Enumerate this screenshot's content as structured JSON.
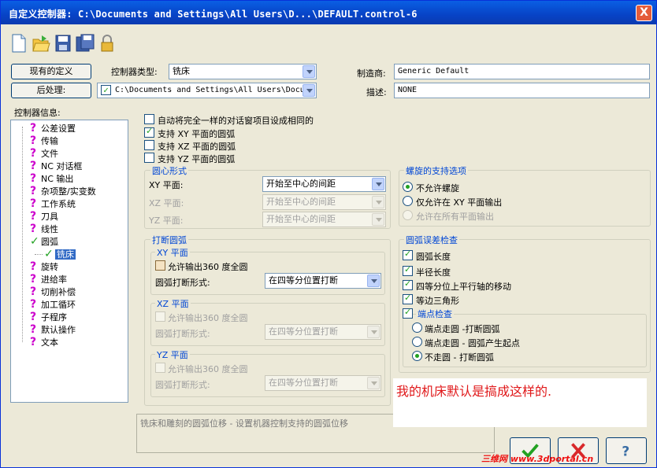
{
  "window": {
    "title": "自定义控制器: C:\\Documents and Settings\\All Users\\D...\\DEFAULT.control-6",
    "close_glyph": "X"
  },
  "toolbar": {
    "icons": [
      "new-file-icon",
      "open-folder-icon",
      "save-icon",
      "save-as-icon",
      "lock-icon"
    ]
  },
  "header": {
    "existing_def_label": "现有的定义",
    "post_label": "后处理:",
    "controller_type_label": "控制器类型:",
    "controller_type_value": "铣床",
    "post_path": "C:\\Documents and Settings\\All Users\\Docu",
    "manufacturer_label": "制造商:",
    "manufacturer_value": "Generic Default",
    "description_label": "描述:",
    "description_value": "NONE"
  },
  "tree": {
    "title": "控制器信息:",
    "items": [
      {
        "label": "公差设置"
      },
      {
        "label": "传输"
      },
      {
        "label": "文件"
      },
      {
        "label": "NC 对话框"
      },
      {
        "label": "NC 输出"
      },
      {
        "label": "杂项整/实变数"
      },
      {
        "label": "工作系统"
      },
      {
        "label": "刀具"
      },
      {
        "label": "线性"
      },
      {
        "label": "圆弧"
      },
      {
        "label": "铣床"
      },
      {
        "label": "旋转"
      },
      {
        "label": "进给率"
      },
      {
        "label": "切削补偿"
      },
      {
        "label": "加工循环"
      },
      {
        "label": "子程序"
      },
      {
        "label": "默认操作"
      },
      {
        "label": "文本"
      }
    ]
  },
  "options": {
    "auto_set_same": "自动将完全一样的对话窗项目设成相同的",
    "support_xy": "支持 XY 平面的圆弧",
    "support_xz": "支持 XZ 平面的圆弧",
    "support_yz": "支持 YZ 平面的圆弧"
  },
  "center_form": {
    "title": "圆心形式",
    "xy_label": "XY 平面:",
    "xz_label": "XZ 平面:",
    "yz_label": "YZ 平面:",
    "xy_value": "开始至中心的间距",
    "xz_value": "开始至中心的间距",
    "yz_value": "开始至中心的间距"
  },
  "break_arc": {
    "title": "打断圆弧",
    "xy_title": "XY 平面",
    "xz_title": "XZ 平面",
    "yz_title": "YZ 平面",
    "allow_360": "允许输出360 度全圆",
    "break_form_label": "圆弧打断形式:",
    "break_form_value": "在四等分位置打断"
  },
  "helix": {
    "title": "螺旋的支持选项",
    "not_allowed": "不允许螺旋",
    "xy_only": "仅允许在 XY 平面输出",
    "all_planes": "允许在所有平面输出"
  },
  "arc_error": {
    "title": "圆弧误差检查",
    "arc_length": "圆弧长度",
    "radius_length": "半径长度",
    "quadrant_move": "四等分位上平行轴的移动",
    "equilateral": "等边三角形",
    "endpoint_check": "端点检查",
    "ep_break": "端点走圆 -打断圆弧",
    "ep_start": "端点走圆 - 圆弧产生起点",
    "ep_none": "不走圆 - 打断圆弧"
  },
  "status_text": "铣床和雕刻的圆弧位移 - 设置机器控制支持的圆弧位移",
  "note_text": "我的机床默认是搞成这样的.",
  "watermark": "三维网 www.3dportal.cn",
  "colors": {
    "title_bar": "#0743C6",
    "group_title": "#0046D5",
    "note_text": "#E0181A",
    "check": "#21A121"
  }
}
